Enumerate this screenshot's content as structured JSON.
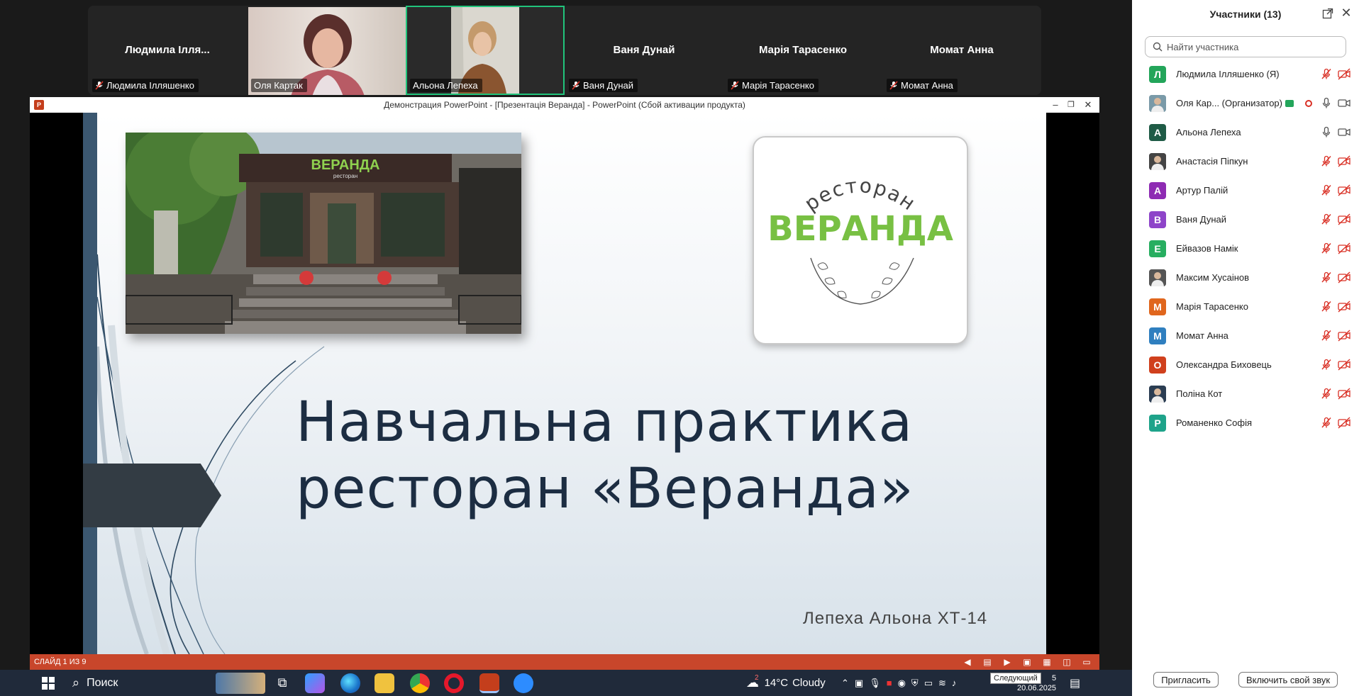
{
  "video_strip": {
    "tiles": [
      {
        "name": "Людмила Ілля...",
        "label": "Людмила Ілляшенко",
        "muted": true,
        "video": false
      },
      {
        "name": "",
        "label": "Оля Картак",
        "muted": false,
        "video": true
      },
      {
        "name": "",
        "label": "Альона Лепеха",
        "muted": false,
        "video": true,
        "active": true
      },
      {
        "name": "Ваня Дунай",
        "label": "Ваня Дунай",
        "muted": true,
        "video": false
      },
      {
        "name": "Марія Тарасенко",
        "label": "Марія Тарасенко",
        "muted": true,
        "video": false
      },
      {
        "name": "Момат Анна",
        "label": "Момат Анна",
        "muted": true,
        "video": false
      }
    ]
  },
  "ppt": {
    "window_title": "Демонстрация PowerPoint - [Презентація Веранда] - PowerPoint (Сбой активации продукта)",
    "app_icon": "P",
    "slide": {
      "title_line1": "Навчальна практика",
      "title_line2": "ресторан «Веранда»",
      "author": "Лепеха Альона ХТ-14",
      "photo_sign": "ВЕРАНДА",
      "photo_sign_sub": "ресторан",
      "logo_top": "ресторан",
      "logo_main": "ВЕРАНДА"
    },
    "status": "СЛАЙД 1 ИЗ 9"
  },
  "taskbar": {
    "search_label": "Поиск",
    "weather_temp": "14°C",
    "weather_text": "Cloudy",
    "weather_badge": "2",
    "time": "5",
    "date": "20.06.2025",
    "tooltip": "Следующий"
  },
  "panel": {
    "title": "Участники (13)",
    "search_placeholder": "Найти участника",
    "participants": [
      {
        "initial": "Л",
        "name": "Людмила Ілляшенко (Я)",
        "color": "#23a55a",
        "mic": "off",
        "cam": "off"
      },
      {
        "initial": "",
        "name": "Оля Кар... (Организатор)",
        "color": "#7a9aa8",
        "mic": "on",
        "cam": "on",
        "photo": true,
        "share": true,
        "rec": true
      },
      {
        "initial": "А",
        "name": "Альона Лепеха",
        "color": "#1f5b46",
        "mic": "on",
        "cam": "on"
      },
      {
        "initial": "",
        "name": "Анастасія Піпкун",
        "color": "#444444",
        "mic": "off",
        "cam": "off",
        "photo": true
      },
      {
        "initial": "А",
        "name": "Артур Палій",
        "color": "#8e2bb3",
        "mic": "off",
        "cam": "off"
      },
      {
        "initial": "В",
        "name": "Ваня Дунай",
        "color": "#8e44c9",
        "mic": "off",
        "cam": "off"
      },
      {
        "initial": "Е",
        "name": "Ейвазов Намік",
        "color": "#27ae60",
        "mic": "off",
        "cam": "off"
      },
      {
        "initial": "",
        "name": "Максим Хусаінов",
        "color": "#555555",
        "mic": "off",
        "cam": "off",
        "photo": true
      },
      {
        "initial": "М",
        "name": "Марія Тарасенко",
        "color": "#e0661d",
        "mic": "off",
        "cam": "off"
      },
      {
        "initial": "М",
        "name": "Момат Анна",
        "color": "#2f7fbf",
        "mic": "off",
        "cam": "off"
      },
      {
        "initial": "О",
        "name": "Олександра Биховець",
        "color": "#d0401d",
        "mic": "off",
        "cam": "off"
      },
      {
        "initial": "",
        "name": "Поліна Кот",
        "color": "#2b3d52",
        "mic": "off",
        "cam": "off",
        "photo": true
      },
      {
        "initial": "Р",
        "name": "Романенко Софія",
        "color": "#1ea38a",
        "mic": "off",
        "cam": "off"
      }
    ],
    "invite_label": "Пригласить",
    "unmute_label": "Включить свой звук"
  },
  "colors": {
    "active_speaker": "#21c47b",
    "ppt_status": "#c8462b",
    "mute_red": "#d93025",
    "slide_title": "#1c2d42",
    "logo_green": "#78c043"
  }
}
